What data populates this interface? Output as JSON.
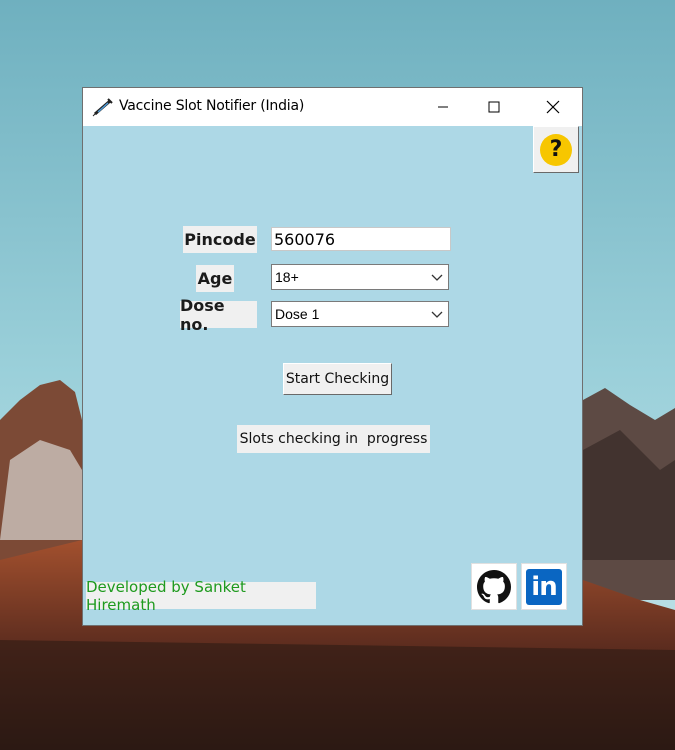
{
  "window": {
    "title": "Vaccine Slot Notifier (India)",
    "minimize_icon": "minimize-icon",
    "maximize_icon": "maximize-icon",
    "close_icon": "close-icon"
  },
  "help": {
    "label": "?",
    "icon": "help-icon"
  },
  "form": {
    "pincode_label": "Pincode",
    "pincode_value": "560076",
    "age_label": "Age",
    "age_value": "18+",
    "dose_label": "Dose no.",
    "dose_value": "Dose 1"
  },
  "actions": {
    "start_label": "Start Checking"
  },
  "status": {
    "text": "Slots checking in  progress"
  },
  "footer": {
    "credit": "Developed by Sanket Hiremath",
    "github_icon": "github-icon",
    "linkedin_icon": "linkedin-icon",
    "linkedin_text": "in"
  },
  "colors": {
    "client_bg": "#add8e6",
    "credit_text": "#1e9a1e",
    "help_yellow": "#f7c600",
    "linkedin_blue": "#0a66c2"
  }
}
